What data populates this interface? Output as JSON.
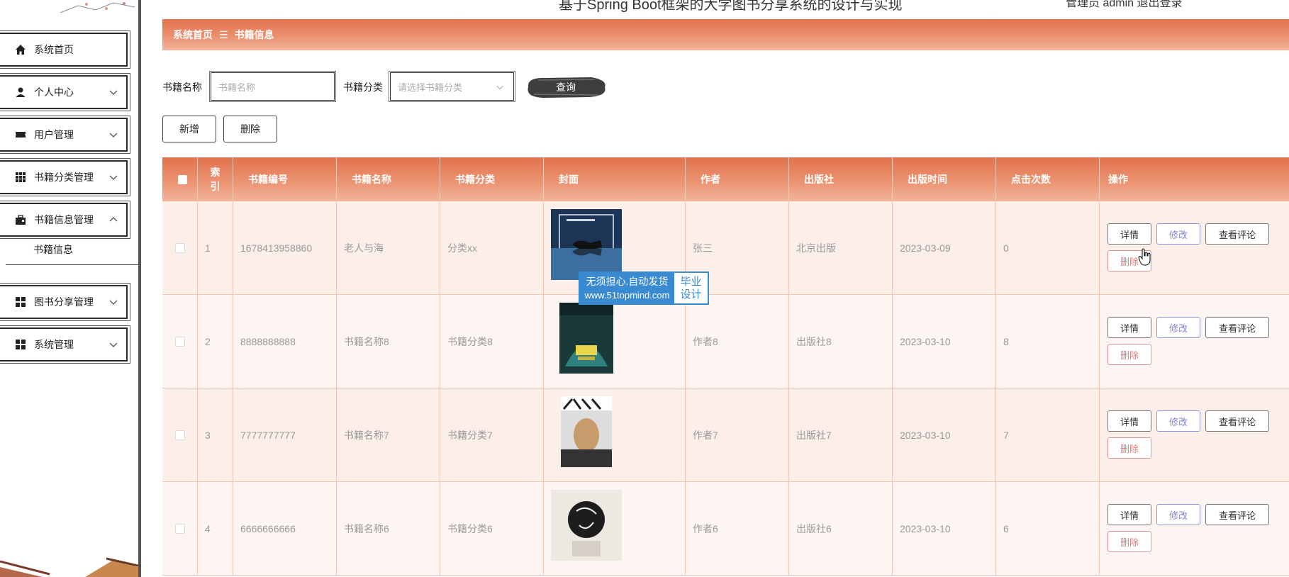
{
  "header": {
    "title": "基于Spring Boot框架的大学图书分享系统的设计与实现",
    "user_text": "管理员 admin  退出登录"
  },
  "sidebar": {
    "items": [
      {
        "label": "系统首页",
        "icon": "home-icon"
      },
      {
        "label": "个人中心",
        "icon": "user-icon"
      },
      {
        "label": "用户管理",
        "icon": "ticket-icon"
      },
      {
        "label": "书籍分类管理",
        "icon": "grid-icon"
      },
      {
        "label": "书籍信息管理",
        "icon": "briefcase-icon"
      },
      {
        "label": "图书分享管理",
        "icon": "grid-icon"
      },
      {
        "label": "系统管理",
        "icon": "grid-icon"
      }
    ],
    "sub_item": "书籍信息"
  },
  "breadcrumb": {
    "home": "系统首页",
    "separator": "☰",
    "current": "书籍信息"
  },
  "search": {
    "name_label": "书籍名称",
    "name_placeholder": "书籍名称",
    "category_label": "书籍分类",
    "category_placeholder": "请选择书籍分类",
    "query_button": "查询"
  },
  "actions": {
    "add": "新增",
    "delete": "删除"
  },
  "table": {
    "columns": [
      "索引",
      "书籍编号",
      "书籍名称",
      "书籍分类",
      "封面",
      "作者",
      "出版社",
      "出版时间",
      "点击次数",
      "操作"
    ],
    "index_header_line1": "索",
    "index_header_line2": "引",
    "rows": [
      {
        "index": "1",
        "code": "1678413958860",
        "name": "老人与海",
        "category": "分类xx",
        "author": "张三",
        "publisher": "北京出版",
        "date": "2023-03-09",
        "clicks": "0"
      },
      {
        "index": "2",
        "code": "8888888888",
        "name": "书籍名称8",
        "category": "书籍分类8",
        "author": "作者8",
        "publisher": "出版社8",
        "date": "2023-03-10",
        "clicks": "8"
      },
      {
        "index": "3",
        "code": "7777777777",
        "name": "书籍名称7",
        "category": "书籍分类7",
        "author": "作者7",
        "publisher": "出版社7",
        "date": "2023-03-10",
        "clicks": "7"
      },
      {
        "index": "4",
        "code": "6666666666",
        "name": "书籍名称6",
        "category": "书籍分类6",
        "author": "作者6",
        "publisher": "出版社6",
        "date": "2023-03-10",
        "clicks": "6"
      }
    ],
    "op_labels": {
      "detail": "详情",
      "edit": "修改",
      "comments": "查看评论",
      "delete": "删除"
    }
  },
  "watermark": {
    "line1": "无须担心.自动发货",
    "line2": "www.51topmind.com",
    "right1": "毕业",
    "right2": "设计"
  },
  "colors": {
    "accent": "#e2724d",
    "accent_light": "#f2b49b",
    "row_bg": "#fcefea",
    "edit": "#7c84d8",
    "delete": "#e07b7b"
  }
}
